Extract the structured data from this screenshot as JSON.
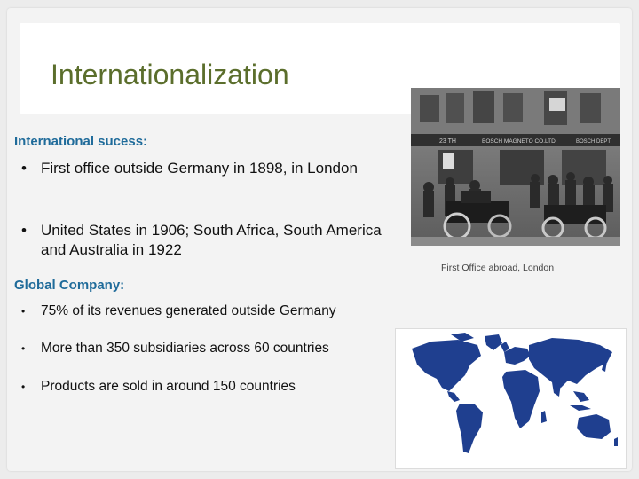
{
  "slide": {
    "title": "Internationalization",
    "section1": {
      "heading": "International sucess:",
      "bullets": [
        {
          "marker": "•",
          "text": "First office outside Germany in 1898, in London"
        },
        {
          "marker": "•",
          "text": "United States in 1906;  South Africa, South America and Australia in 1922"
        }
      ]
    },
    "section2": {
      "heading": "Global Company:",
      "bullets": [
        {
          "marker": "•",
          "text": "75% of its revenues generated outside Germany"
        },
        {
          "marker": "•",
          "text": "More than 350 subsidiaries across 60 countries"
        },
        {
          "marker": "•",
          "text": "Products are sold in around 150 countries"
        }
      ]
    },
    "photo": {
      "caption": "First Office abroad, London",
      "sign_left": "23 TH",
      "sign_center": "BOSCH MAGNETO CO.LTD",
      "sign_right": "BOSCH DEPT"
    },
    "map": {
      "icon": "world-map-icon",
      "color": "#1f3f8f"
    }
  }
}
